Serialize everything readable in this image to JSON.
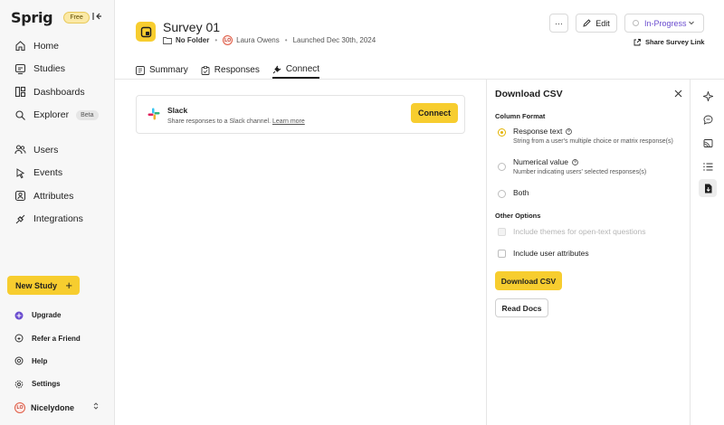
{
  "brand": {
    "logo": "Sprig",
    "plan_badge": "Free"
  },
  "sidebar": {
    "items": [
      {
        "label": "Home",
        "icon": "home-icon"
      },
      {
        "label": "Studies",
        "icon": "studies-icon"
      },
      {
        "label": "Dashboards",
        "icon": "dashboard-icon"
      },
      {
        "label": "Explorer",
        "icon": "explorer-icon",
        "badge": "Beta"
      },
      {
        "label": "Users",
        "icon": "users-icon"
      },
      {
        "label": "Events",
        "icon": "events-icon"
      },
      {
        "label": "Attributes",
        "icon": "attributes-icon"
      },
      {
        "label": "Integrations",
        "icon": "integrations-icon"
      }
    ],
    "new_study_label": "New Study",
    "bottom_items": [
      {
        "label": "Upgrade",
        "icon": "upgrade-icon"
      },
      {
        "label": "Refer a Friend",
        "icon": "refer-icon"
      },
      {
        "label": "Help",
        "icon": "help-icon"
      },
      {
        "label": "Settings",
        "icon": "settings-icon"
      }
    ],
    "account": {
      "initials": "LO",
      "name": "Nicelydone"
    }
  },
  "header": {
    "title": "Survey 01",
    "folder": "No Folder",
    "owner_initials": "LO",
    "owner": "Laura Owens",
    "launched": "Launched Dec 30th, 2024",
    "more_label": "···",
    "edit_label": "Edit",
    "status": "In-Progress",
    "share_label": "Share Survey Link"
  },
  "tabs": [
    {
      "label": "Summary",
      "icon": "summary-icon",
      "active": false
    },
    {
      "label": "Responses",
      "icon": "responses-icon",
      "active": false
    },
    {
      "label": "Connect",
      "icon": "connect-icon",
      "active": true
    }
  ],
  "slack": {
    "name": "Slack",
    "description": "Share responses to a Slack channel.",
    "learn_more": "Learn more",
    "connect_label": "Connect"
  },
  "panel": {
    "title": "Download CSV",
    "column_format_label": "Column Format",
    "options": [
      {
        "label": "Response text",
        "sub": "String from a user's multiple choice or matrix response(s)",
        "selected": true
      },
      {
        "label": "Numerical value",
        "sub": "Number indicating users' selected responses(s)",
        "selected": false
      },
      {
        "label": "Both",
        "sub": "",
        "selected": false
      }
    ],
    "other_options_label": "Other Options",
    "checks": [
      {
        "label": "Include themes for open-text questions",
        "disabled": true
      },
      {
        "label": "Include user attributes",
        "disabled": false
      }
    ],
    "download_label": "Download CSV",
    "docs_label": "Read Docs"
  },
  "colors": {
    "accent": "#f7cd2f",
    "status": "#6a4ccf",
    "avatar": "#e05c45"
  }
}
